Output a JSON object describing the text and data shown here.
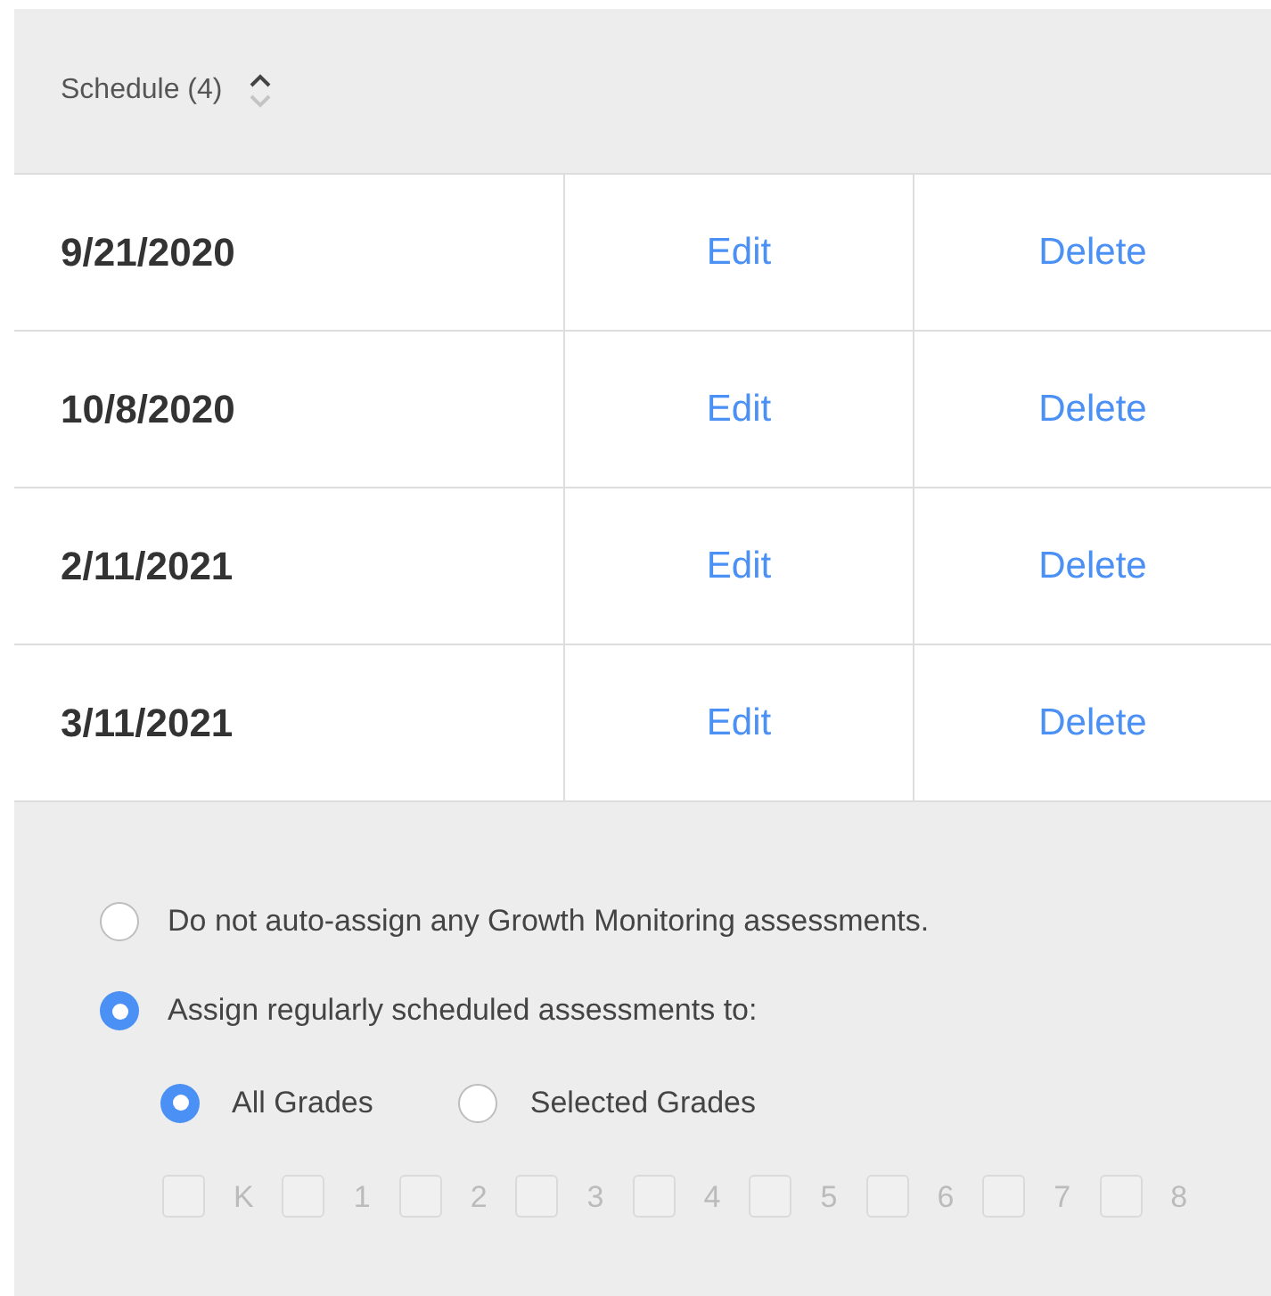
{
  "header": {
    "title": "Schedule (4)"
  },
  "rows": [
    {
      "date": "9/21/2020",
      "edit": "Edit",
      "delete": "Delete"
    },
    {
      "date": "10/8/2020",
      "edit": "Edit",
      "delete": "Delete"
    },
    {
      "date": "2/11/2021",
      "edit": "Edit",
      "delete": "Delete"
    },
    {
      "date": "3/11/2021",
      "edit": "Edit",
      "delete": "Delete"
    }
  ],
  "assign_options": [
    {
      "label": "Do not auto-assign any Growth Monitoring assessments.",
      "selected": false
    },
    {
      "label": "Assign regularly scheduled assessments to:",
      "selected": true
    }
  ],
  "grade_scope": [
    {
      "label": "All Grades",
      "selected": true
    },
    {
      "label": "Selected Grades",
      "selected": false
    }
  ],
  "grades": [
    {
      "label": "K",
      "checked": false,
      "disabled": true
    },
    {
      "label": "1",
      "checked": false,
      "disabled": true
    },
    {
      "label": "2",
      "checked": false,
      "disabled": true
    },
    {
      "label": "3",
      "checked": false,
      "disabled": true
    },
    {
      "label": "4",
      "checked": false,
      "disabled": true
    },
    {
      "label": "5",
      "checked": false,
      "disabled": true
    },
    {
      "label": "6",
      "checked": false,
      "disabled": true
    },
    {
      "label": "7",
      "checked": false,
      "disabled": true
    },
    {
      "label": "8",
      "checked": false,
      "disabled": true
    }
  ]
}
